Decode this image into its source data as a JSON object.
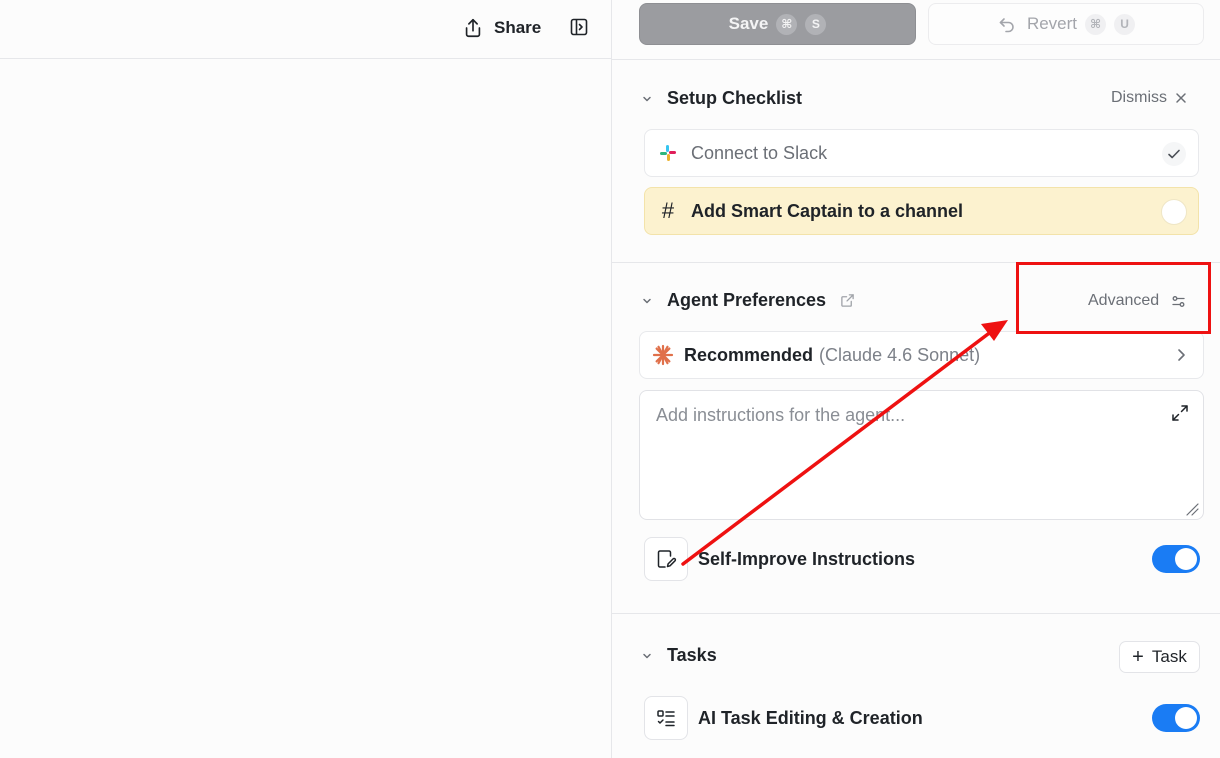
{
  "header": {
    "share_label": "Share"
  },
  "toolbar": {
    "save_label": "Save",
    "save_keys": [
      "⌘",
      "S"
    ],
    "revert_label": "Revert",
    "revert_keys": [
      "⌘",
      "U"
    ]
  },
  "setup_checklist": {
    "title": "Setup Checklist",
    "dismiss_label": "Dismiss",
    "items": [
      {
        "label": "Connect to Slack",
        "status": "done"
      },
      {
        "label": "Add Smart Captain to a channel",
        "status": "pending"
      }
    ]
  },
  "agent_preferences": {
    "title": "Agent Preferences",
    "advanced_label": "Advanced",
    "model_label": "Recommended",
    "model_detail": "(Claude 4.6 Sonnet)",
    "instructions_placeholder": "Add instructions for the agent...",
    "instructions_value": "",
    "self_improve_label": "Self-Improve Instructions",
    "self_improve_enabled": true
  },
  "tasks": {
    "title": "Tasks",
    "add_task_label": "Task",
    "ai_task_label": "AI Task Editing & Creation",
    "ai_task_enabled": true
  },
  "colors": {
    "accent": "#1a7cf4",
    "highlight_row": "#fcf2cf",
    "annotation": "#ee1111",
    "model_spark": "#e0704a"
  }
}
